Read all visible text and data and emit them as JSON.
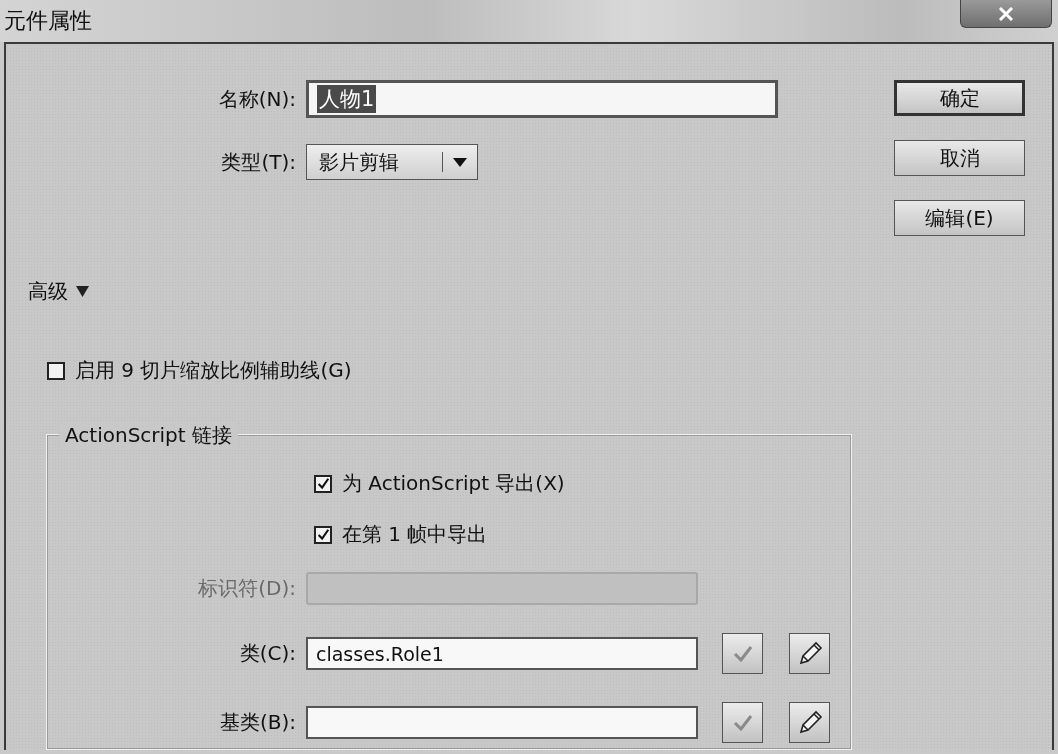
{
  "window": {
    "title": "元件属性"
  },
  "name_field": {
    "label": "名称(N):",
    "value": "人物1",
    "selected": true
  },
  "type_field": {
    "label": "类型(T):",
    "value": "影片剪辑"
  },
  "buttons": [
    {
      "label": "确定",
      "default": true
    },
    {
      "label": "取消",
      "default": false
    },
    {
      "label": "编辑(E)",
      "default": false
    }
  ],
  "advanced": {
    "label": "高级",
    "expanded": true
  },
  "scale9": {
    "label": "启用 9 切片缩放比例辅助线(G)",
    "checked": false
  },
  "linkage": {
    "title": "ActionScript 链接",
    "options": [
      {
        "label": "为 ActionScript 导出(X)",
        "checked": true
      },
      {
        "label": "在第 1 帧中导出",
        "checked": true
      }
    ],
    "fields": [
      {
        "kind": "plain",
        "label": "标识符(D):",
        "disabled": true
      },
      {
        "kind": "class",
        "label": "类(C):",
        "value": "classes.Role1",
        "disabled": false
      },
      {
        "kind": "class",
        "label": "基类(B):",
        "disabled": false
      }
    ]
  }
}
